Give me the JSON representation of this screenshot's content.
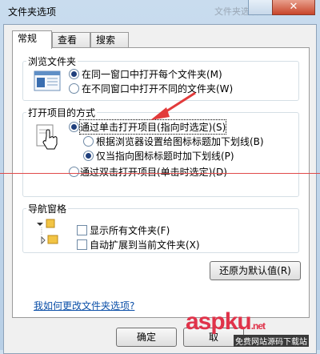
{
  "window": {
    "title": "文件夹选项",
    "background_title": "文件夹选项",
    "close_glyph": "✕"
  },
  "tabs": [
    {
      "label": "常规",
      "active": true
    },
    {
      "label": "查看",
      "active": false
    },
    {
      "label": "搜索",
      "active": false
    }
  ],
  "browse": {
    "legend": "浏览文件夹",
    "options": [
      {
        "label": "在同一窗口中打开每个文件夹(M)",
        "selected": true
      },
      {
        "label": "在不同窗口中打开不同的文件夹(W)",
        "selected": false
      }
    ]
  },
  "click": {
    "legend": "打开项目的方式",
    "single": {
      "label": "通过单击打开项目(指向时选定)(S)",
      "selected": true
    },
    "sub_options": [
      {
        "label": "根据浏览器设置给图标标题加下划线(B)",
        "selected": false
      },
      {
        "label": "仅当指向图标标题时加下划线(P)",
        "selected": true
      }
    ],
    "double": {
      "label": "通过双击打开项目(单击时选定)(D)",
      "selected": false
    }
  },
  "nav": {
    "legend": "导航窗格",
    "options": [
      {
        "label": "显示所有文件夹(F)",
        "checked": false
      },
      {
        "label": "自动扩展到当前文件夹(X)",
        "checked": false
      }
    ]
  },
  "restore_label": "还原为默认值(R)",
  "help_link": "我如何更改文件夹选项?",
  "buttons": {
    "ok": "确定",
    "cancel": "取"
  },
  "watermark": {
    "text": "aspku",
    "suffix": ".net",
    "subtext": "免费网站源码下载站"
  },
  "colors": {
    "arrow": "#e23b3b",
    "link": "#0b4fa8",
    "radio_fill": "#1f3f7c"
  }
}
